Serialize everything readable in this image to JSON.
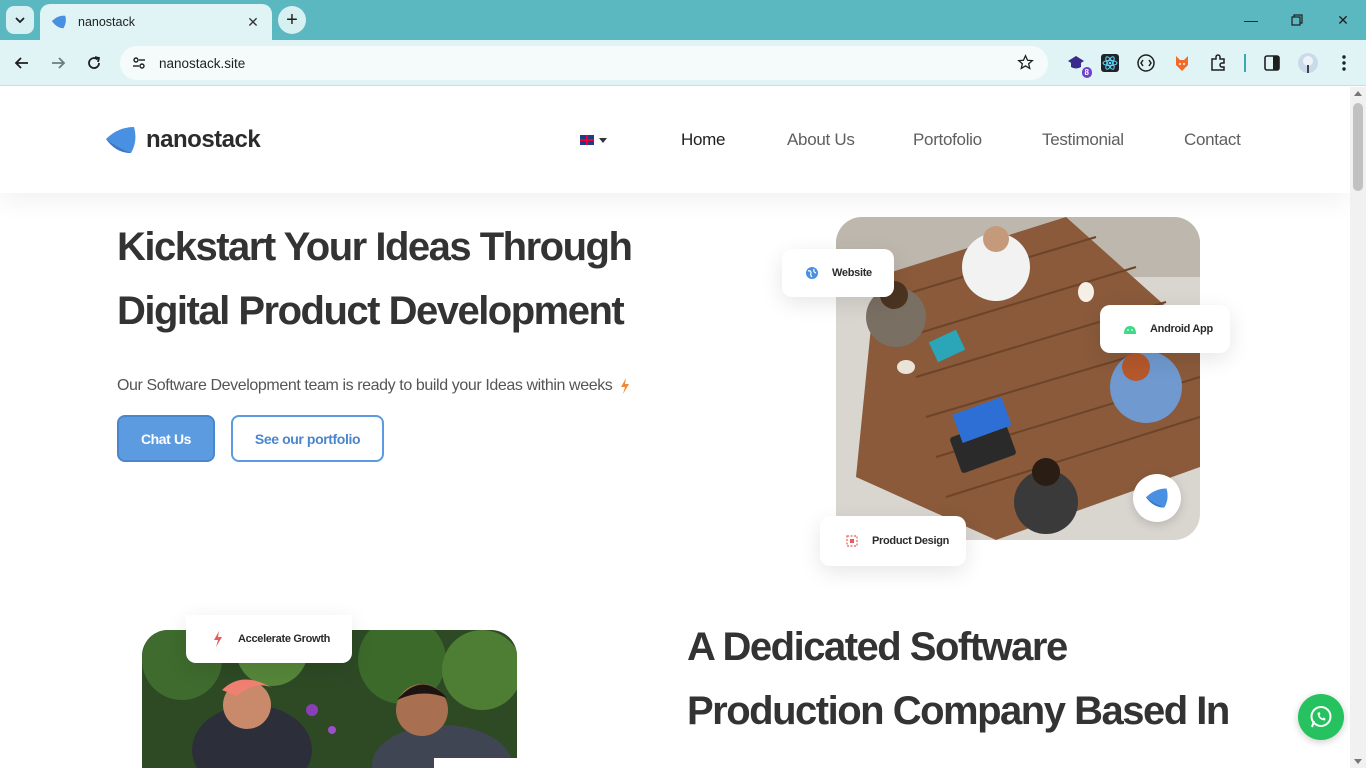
{
  "browser": {
    "tab_title": "nanostack",
    "url": "nanostack.site",
    "extension_badge": "8",
    "colors": {
      "frame": "#5bb8c1",
      "toolbar": "#e1f4f5"
    }
  },
  "header": {
    "logo_text": "nanostack",
    "language": "en-GB",
    "nav": {
      "home": "Home",
      "about": "About Us",
      "portfolio": "Portofolio",
      "testimonial": "Testimonial",
      "contact": "Contact"
    }
  },
  "hero": {
    "title_line1": "Kickstart Your Ideas Through",
    "title_line2": "Digital Product Development",
    "subtitle": "Our Software Development team is ready to build your Ideas within weeks",
    "primary_button": "Chat Us",
    "secondary_button": "See our portfolio",
    "badges": {
      "website": "Website",
      "android": "Android App",
      "product_design": "Product Design"
    }
  },
  "about": {
    "badge": "Accelerate Growth",
    "title_line1": "A Dedicated Software",
    "title_line2": "Production Company Based In"
  },
  "colors": {
    "accent": "#5d9be0",
    "whatsapp": "#25c25f",
    "bolt": "#f08a3a"
  }
}
